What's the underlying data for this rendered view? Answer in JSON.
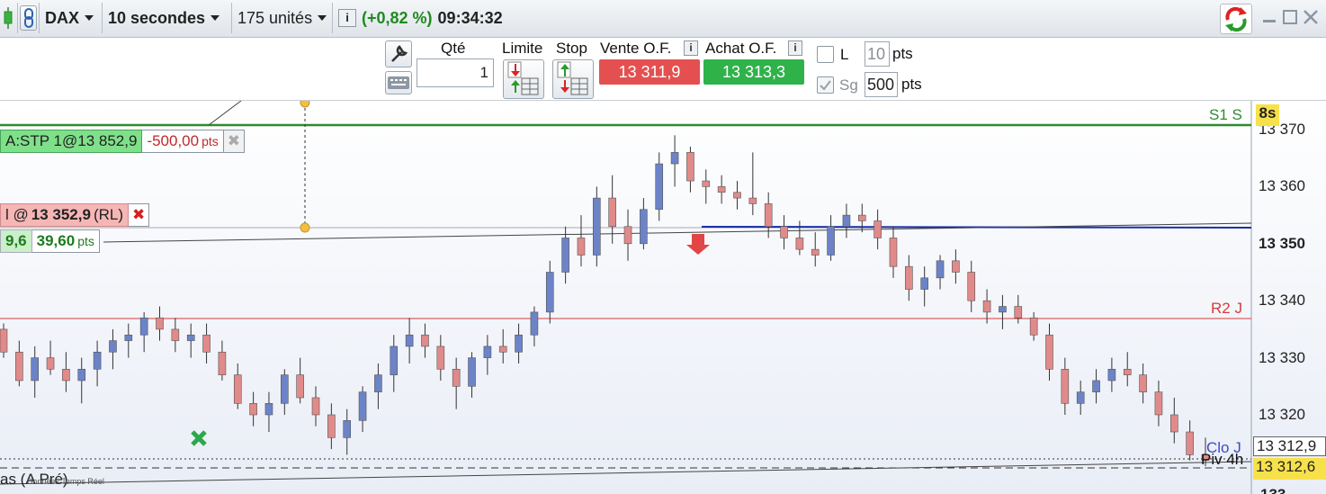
{
  "toolbar": {
    "instrument": "DAX",
    "timeframe": "10 secondes",
    "units": "175 unités",
    "info_icon": "i",
    "change_pct": "(+0,82 %)",
    "time": "09:34:32"
  },
  "ticket": {
    "qty_label": "Qté",
    "qty_value": "1",
    "limit_label": "Limite",
    "stop_label": "Stop",
    "sell_label": "Vente O.F.",
    "buy_label": "Achat O.F.",
    "sell_price": "13 311,9",
    "buy_price": "13 313,3",
    "l_label": "L",
    "l_points": "10",
    "l_unit": "pts",
    "sg_label": "Sg",
    "sg_points": "500",
    "sg_unit": "pts"
  },
  "chart": {
    "timer_badge": "8s",
    "y_ticks": [
      "13 370",
      "13 360",
      "13 350",
      "13 340",
      "13 330",
      "13 320"
    ],
    "y_tick_bottom_partial": "133",
    "price_tags": {
      "clo": "13 312,9",
      "current": "13 312,6"
    },
    "levels": {
      "s1": "S1 S",
      "r2": "R2 J",
      "clo": "Clo J",
      "piv": "Piv 4h"
    },
    "stop_order": {
      "label": "A:STP 1@13 852,9",
      "pts": "-500,00",
      "pts_unit": "pts",
      "close": "✖"
    },
    "limit_order": {
      "label_prefix": "l @",
      "price": "13 352,9",
      "suffix": "(RL)",
      "close": "✖",
      "left_value": "9,6",
      "pts": "39,60",
      "pts_unit": "pts"
    },
    "bottom_caption": "as (A Pré)",
    "bottom_caption_small": "Données Temps Réel",
    "colors": {
      "up": "#6c83c8",
      "down": "#e18a8a",
      "s1": "#2e8b2e",
      "r2": "#d63a3a",
      "trend": "#1b2fa8"
    }
  },
  "chart_data": {
    "type": "candlestick",
    "title": "",
    "ylim": [
      13312,
      13372
    ],
    "ohlc": [
      [
        13335,
        13336,
        13330,
        13331
      ],
      [
        13331,
        13333,
        13325,
        13326
      ],
      [
        13326,
        13332,
        13323,
        13330
      ],
      [
        13330,
        13333,
        13327,
        13328
      ],
      [
        13328,
        13331,
        13324,
        13326
      ],
      [
        13326,
        13330,
        13322,
        13328
      ],
      [
        13328,
        13333,
        13325,
        13331
      ],
      [
        13331,
        13335,
        13328,
        13333
      ],
      [
        13333,
        13336,
        13330,
        13334
      ],
      [
        13334,
        13338,
        13331,
        13337
      ],
      [
        13337,
        13339,
        13333,
        13335
      ],
      [
        13335,
        13337,
        13331,
        13333
      ],
      [
        13333,
        13336,
        13330,
        13334
      ],
      [
        13334,
        13336,
        13329,
        13331
      ],
      [
        13331,
        13333,
        13326,
        13327
      ],
      [
        13327,
        13329,
        13321,
        13322
      ],
      [
        13322,
        13324,
        13318,
        13320
      ],
      [
        13320,
        13324,
        13317,
        13322
      ],
      [
        13322,
        13328,
        13320,
        13327
      ],
      [
        13327,
        13330,
        13322,
        13323
      ],
      [
        13323,
        13325,
        13318,
        13320
      ],
      [
        13320,
        13322,
        13314,
        13316
      ],
      [
        13316,
        13321,
        13313,
        13319
      ],
      [
        13319,
        13325,
        13317,
        13324
      ],
      [
        13324,
        13329,
        13321,
        13327
      ],
      [
        13327,
        13334,
        13324,
        13332
      ],
      [
        13332,
        13337,
        13329,
        13334
      ],
      [
        13334,
        13336,
        13330,
        13332
      ],
      [
        13332,
        13334,
        13326,
        13328
      ],
      [
        13328,
        13330,
        13321,
        13325
      ],
      [
        13325,
        13331,
        13323,
        13330
      ],
      [
        13330,
        13334,
        13327,
        13332
      ],
      [
        13332,
        13335,
        13329,
        13331
      ],
      [
        13331,
        13336,
        13329,
        13334
      ],
      [
        13334,
        13339,
        13332,
        13338
      ],
      [
        13338,
        13347,
        13336,
        13345
      ],
      [
        13345,
        13353,
        13343,
        13351
      ],
      [
        13351,
        13355,
        13346,
        13348
      ],
      [
        13348,
        13360,
        13346,
        13358
      ],
      [
        13358,
        13362,
        13350,
        13353
      ],
      [
        13353,
        13356,
        13347,
        13350
      ],
      [
        13350,
        13358,
        13349,
        13356
      ],
      [
        13356,
        13366,
        13354,
        13364
      ],
      [
        13364,
        13369,
        13360,
        13366
      ],
      [
        13366,
        13367,
        13359,
        13361
      ],
      [
        13361,
        13363,
        13357,
        13360
      ],
      [
        13360,
        13362,
        13357,
        13359
      ],
      [
        13359,
        13361,
        13356,
        13358
      ],
      [
        13358,
        13366,
        13355,
        13357
      ],
      [
        13357,
        13359,
        13351,
        13353
      ],
      [
        13353,
        13355,
        13349,
        13351
      ],
      [
        13351,
        13354,
        13348,
        13349
      ],
      [
        13349,
        13352,
        13346,
        13348
      ],
      [
        13348,
        13355,
        13347,
        13353
      ],
      [
        13353,
        13357,
        13351,
        13355
      ],
      [
        13355,
        13357,
        13352,
        13354
      ],
      [
        13354,
        13356,
        13349,
        13351
      ],
      [
        13351,
        13353,
        13344,
        13346
      ],
      [
        13346,
        13348,
        13340,
        13342
      ],
      [
        13342,
        13346,
        13339,
        13344
      ],
      [
        13344,
        13348,
        13342,
        13347
      ],
      [
        13347,
        13349,
        13343,
        13345
      ],
      [
        13345,
        13347,
        13338,
        13340
      ],
      [
        13340,
        13342,
        13336,
        13338
      ],
      [
        13338,
        13341,
        13335,
        13339
      ],
      [
        13339,
        13341,
        13336,
        13337
      ],
      [
        13337,
        13338,
        13333,
        13334
      ],
      [
        13334,
        13336,
        13326,
        13328
      ],
      [
        13328,
        13330,
        13320,
        13322
      ],
      [
        13322,
        13326,
        13320,
        13324
      ],
      [
        13324,
        13328,
        13322,
        13326
      ],
      [
        13326,
        13330,
        13324,
        13328
      ],
      [
        13328,
        13331,
        13325,
        13327
      ],
      [
        13327,
        13329,
        13322,
        13324
      ],
      [
        13324,
        13326,
        13318,
        13320
      ],
      [
        13320,
        13323,
        13315,
        13317
      ],
      [
        13317,
        13319,
        13312,
        13313
      ],
      [
        13313,
        13316,
        13311,
        13312
      ]
    ]
  }
}
